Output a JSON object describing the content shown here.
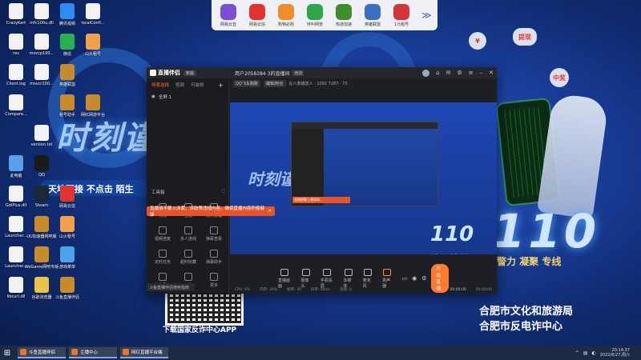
{
  "colors": {
    "accent": "#ff7a2e",
    "wallpaper": "#1a3f9e",
    "tip_red": "#e8542a"
  },
  "top_dock": [
    {
      "label": "网易云音",
      "icon": "music-icon",
      "color": "#7b4fd4"
    },
    {
      "label": "网易云信",
      "icon": "message-icon",
      "color": "#e2342f"
    },
    {
      "label": "购物必购",
      "icon": "shopping-icon",
      "color": "#f08c2a"
    },
    {
      "label": "呼叫网管",
      "icon": "phone-icon",
      "color": "#2da64a"
    },
    {
      "label": "热游加速",
      "icon": "rocket-icon",
      "color": "#3e8e2b"
    },
    {
      "label": "英雄联盟",
      "icon": "game-icon",
      "color": "#3b6fbf"
    },
    {
      "label": "1元租号",
      "icon": "magnet-icon",
      "color": "#d23535"
    }
  ],
  "desktop_icons": [
    {
      "label": "CrazyKart",
      "icon": "document-icon"
    },
    {
      "label": "mfc100u.dll",
      "icon": "document-icon"
    },
    {
      "label": "腾讯视频",
      "icon": "video-icon"
    },
    {
      "label": "localConfi...",
      "icon": "document-icon"
    },
    {
      "label": "res",
      "icon": "document-icon"
    },
    {
      "label": "msvcp100...",
      "icon": "document-icon"
    },
    {
      "label": "微信",
      "icon": "wechat-icon"
    },
    {
      "label": "山火租号",
      "icon": "mountain-icon"
    },
    {
      "label": "Client.log",
      "icon": "document-icon"
    },
    {
      "label": "msvcr100...",
      "icon": "document-icon"
    },
    {
      "label": "英雄联盟",
      "icon": "game-icon"
    },
    {
      "label": "Compare...",
      "icon": "document-icon"
    },
    {
      "label": "租号助手",
      "icon": "game-icon"
    },
    {
      "label": "网红网游平台",
      "icon": "game-icon"
    },
    {
      "label": "version.txt",
      "icon": "document-icon"
    },
    {
      "label": "此电脑",
      "icon": "computer-icon"
    },
    {
      "label": "QQ",
      "icon": "qq-icon"
    },
    {
      "label": "GdiPlus.dll",
      "icon": "document-icon"
    },
    {
      "label": "Steam",
      "icon": "steam-icon"
    },
    {
      "label": "网易云信",
      "icon": "message-icon"
    },
    {
      "label": "Launcher...",
      "icon": "document-icon"
    },
    {
      "label": "UU加速器网吧版",
      "icon": "game-icon"
    },
    {
      "label": "山火租号",
      "icon": "mountain-icon"
    },
    {
      "label": "Launcher...",
      "icon": "document-icon"
    },
    {
      "label": "WeGame网吧专版",
      "icon": "game-icon"
    },
    {
      "label": "游戏菜单",
      "icon": "cloud-icon"
    },
    {
      "label": "libcurl.dll",
      "icon": "document-icon"
    },
    {
      "label": "谷歌浏览器",
      "icon": "chrome-icon"
    },
    {
      "label": "斗鱼直播伴侣",
      "icon": "game-icon"
    }
  ],
  "wallpaper": {
    "slogan": "时刻谨",
    "band": "天地不接 不点击  陌生",
    "big_number": "110",
    "slogan2": "警力 凝聚 专线",
    "qr_label": "下载国家反诈中心APP",
    "org_line1": "合肥市文化和旅游局",
    "org_line2": "合肥市反电诈中心",
    "bubble1": "提现",
    "bubble2": "¥",
    "bubble3": "中奖"
  },
  "app": {
    "logo_text": "直播伴侣",
    "version_badge": "新版",
    "room_title": "用户2058384 3的直播间",
    "room_badge": "修改",
    "left_tabs": [
      "场景选择",
      "视频",
      "可装修"
    ],
    "active_tab": "场景选择",
    "scene_name": "全屏 1",
    "tools_title": "工具箱",
    "tools": [
      "礼物",
      "主题",
      "房间管理",
      "视频连麦",
      "多人连线",
      "弹幕查看",
      "定时任务",
      "超时收藏",
      "弹幕助手",
      "礼物展示",
      "公告",
      "更多"
    ],
    "tip_text": "直播请不要上涉黄、涉政等违规内容，确保直播内容积极健康",
    "subbar_chips": [
      "QQ飞车跑跑",
      "编辑/粉丝"
    ],
    "subbar_text": "在人数播放人 · 1092 7287 · 75",
    "preview_tip": "直播提醒上播须知...",
    "controls": [
      "直播画面",
      "摄像头",
      "手机投屏",
      "多媒体",
      "麦克风",
      "扬声器"
    ],
    "start_button": "开始直播",
    "status_items": [
      "CPU: 6%",
      "内存: 24%",
      "帧率: 30",
      "码率: 0kb/s",
      "丢帧: 0"
    ],
    "rec_time": "00:00:00",
    "live_time": "00:00:00",
    "mini_window": "斗鱼直播伴侣使用指南"
  },
  "taskbar": {
    "tasks": [
      "斗鱼直播伴侣",
      "主播中心",
      "网红直播平台端"
    ],
    "time": "20:14:37",
    "date": "2022/8/27,周六"
  }
}
